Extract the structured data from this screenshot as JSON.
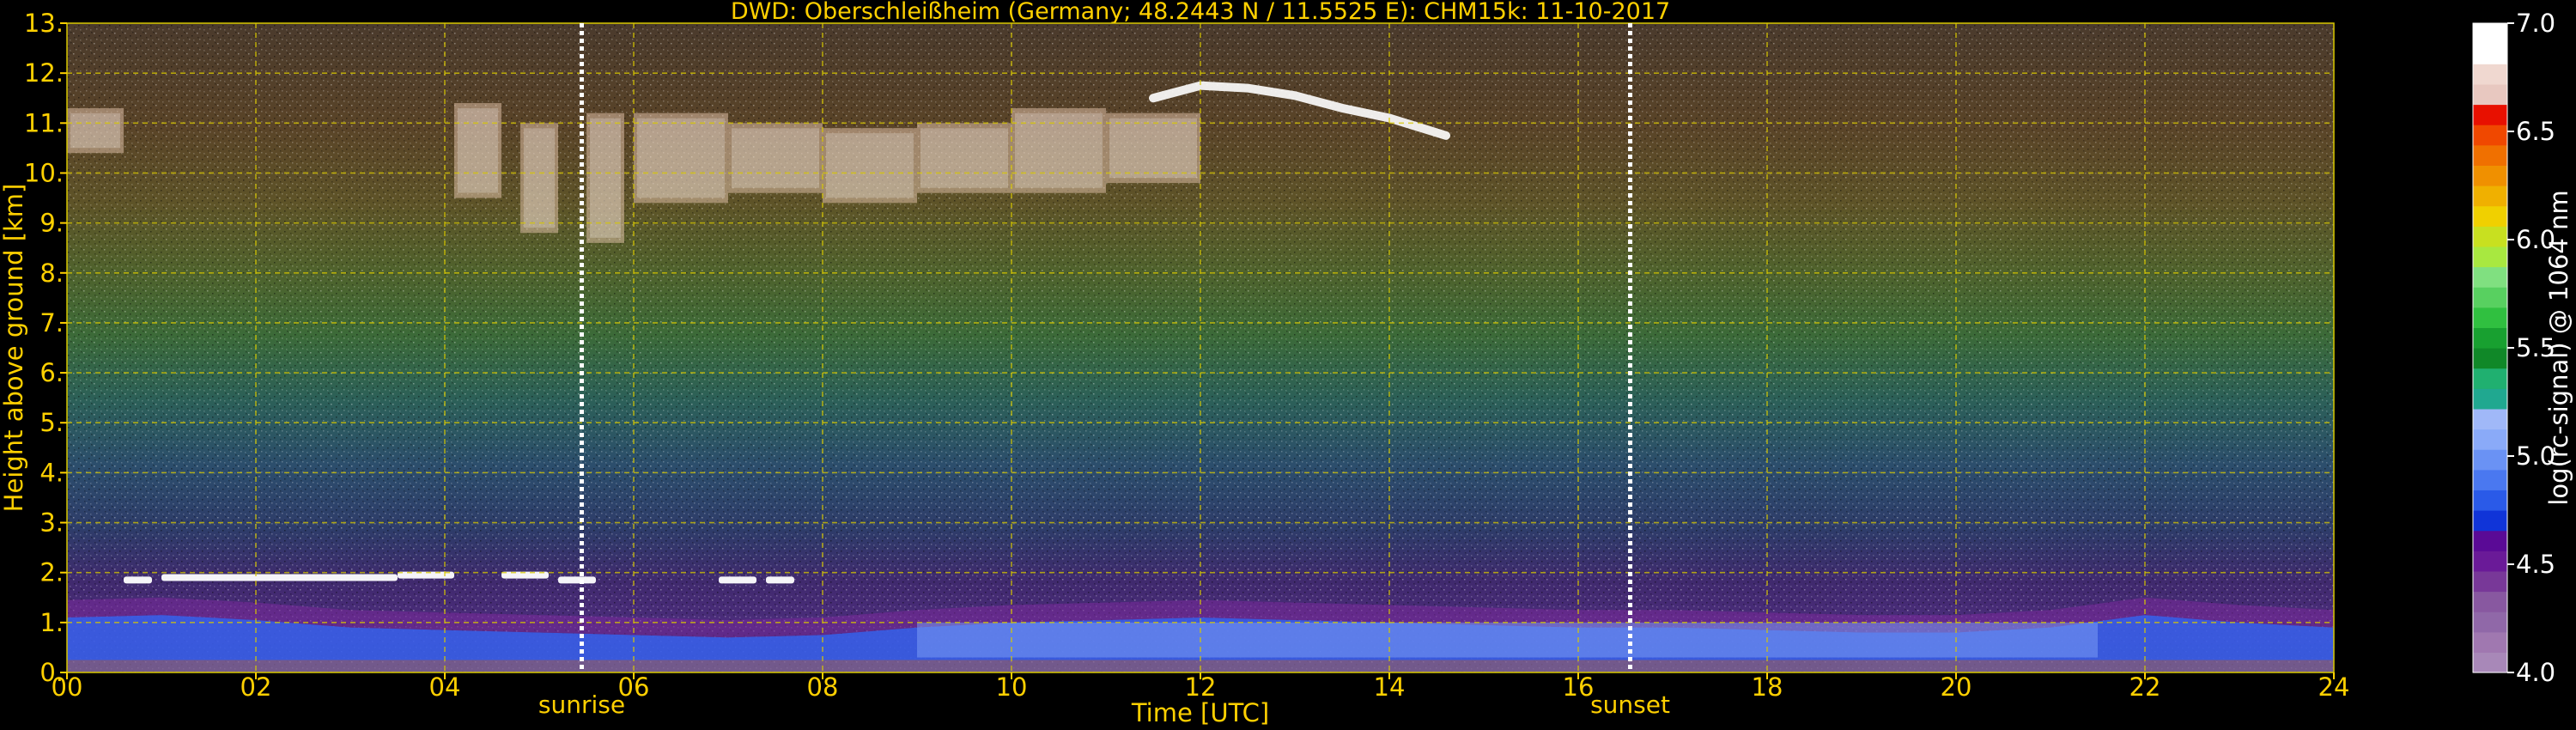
{
  "chart_data": {
    "type": "heatmap",
    "title": "DWD: Oberschleißheim (Germany; 48.2443 N / 11.5525 E):    CHM15k: 11-10-2017",
    "xlabel": "Time [UTC]",
    "ylabel": "Height above ground [km]",
    "xlim": [
      0,
      24
    ],
    "ylim": [
      0,
      13
    ],
    "x_ticks": [
      "00",
      "02",
      "04",
      "06",
      "08",
      "10",
      "12",
      "14",
      "16",
      "18",
      "20",
      "22",
      "24"
    ],
    "y_ticks": [
      "0.",
      "1.",
      "2.",
      "3.",
      "4.",
      "5.",
      "6.",
      "7.",
      "8.",
      "9.",
      "10.",
      "11.",
      "12.",
      "13."
    ],
    "grid": true,
    "events": [
      {
        "label": "sunrise",
        "time": 5.45
      },
      {
        "label": "sunset",
        "time": 16.55
      }
    ],
    "colorbar": {
      "label": "log(rc-signal) @ 1064 nm",
      "range": [
        4.0,
        7.0
      ],
      "ticks": [
        "4.0",
        "4.5",
        "5.0",
        "5.5",
        "6.0",
        "6.5",
        "7.0"
      ],
      "colors": [
        "#a888b8",
        "#a078b0",
        "#9068a8",
        "#8858a0",
        "#783898",
        "#6a1a98",
        "#5a0a96",
        "#1034d8",
        "#2a5ae8",
        "#4a78f0",
        "#6a92f4",
        "#8aaaf8",
        "#a0b8f8",
        "#20a890",
        "#20b070",
        "#108828",
        "#18a030",
        "#30c040",
        "#58d060",
        "#80e080",
        "#a8e840",
        "#c8e020",
        "#f0d000",
        "#f0b000",
        "#f09000",
        "#f07000",
        "#f04800",
        "#e81000",
        "#e8c8c0",
        "#f0d8d0",
        "#ffffff",
        "#ffffff"
      ]
    },
    "features": {
      "boundary_layer": [
        [
          0,
          1.1
        ],
        [
          1,
          1.15
        ],
        [
          2,
          1.05
        ],
        [
          3,
          0.9
        ],
        [
          4,
          0.85
        ],
        [
          5,
          0.8
        ],
        [
          6,
          0.75
        ],
        [
          7,
          0.7
        ],
        [
          8,
          0.75
        ],
        [
          9,
          0.9
        ],
        [
          10,
          1.0
        ],
        [
          11,
          1.05
        ],
        [
          12,
          1.1
        ],
        [
          13,
          1.05
        ],
        [
          14,
          1.0
        ],
        [
          15,
          0.95
        ],
        [
          16,
          0.9
        ],
        [
          17,
          0.9
        ],
        [
          18,
          0.85
        ],
        [
          19,
          0.8
        ],
        [
          20,
          0.8
        ],
        [
          21,
          0.9
        ],
        [
          22,
          1.15
        ],
        [
          23,
          1.0
        ],
        [
          24,
          0.9
        ]
      ],
      "low_cloud": [
        [
          0.6,
          0.9,
          1.85
        ],
        [
          1.0,
          3.5,
          1.9
        ],
        [
          3.5,
          4.1,
          1.95
        ],
        [
          4.6,
          5.1,
          1.95
        ],
        [
          5.2,
          5.6,
          1.85
        ],
        [
          6.9,
          7.3,
          1.85
        ],
        [
          7.4,
          7.7,
          1.85
        ]
      ],
      "cirrus_patches": [
        [
          0.0,
          0.6,
          10.4,
          11.3
        ],
        [
          4.1,
          4.6,
          9.5,
          11.4
        ],
        [
          4.8,
          5.2,
          8.8,
          11.0
        ],
        [
          5.5,
          5.9,
          8.6,
          11.2
        ],
        [
          6.0,
          7.0,
          9.4,
          11.2
        ],
        [
          7.0,
          8.0,
          9.6,
          11.0
        ],
        [
          8.0,
          9.0,
          9.4,
          10.9
        ],
        [
          9.0,
          10.0,
          9.6,
          11.0
        ],
        [
          10.0,
          11.0,
          9.6,
          11.3
        ],
        [
          11.0,
          12.0,
          9.8,
          11.2
        ]
      ],
      "cirrus_top": [
        [
          11.5,
          11.5
        ],
        [
          12.0,
          11.75
        ],
        [
          12.5,
          11.7
        ],
        [
          13.0,
          11.55
        ],
        [
          13.5,
          11.3
        ],
        [
          14.0,
          11.1
        ],
        [
          14.6,
          10.75
        ]
      ]
    }
  }
}
